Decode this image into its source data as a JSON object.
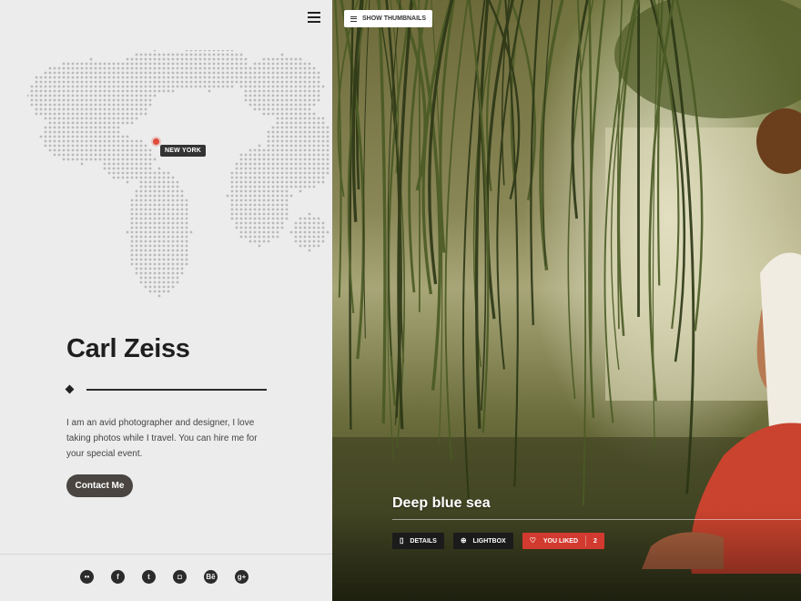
{
  "profile": {
    "name": "Carl Zeiss",
    "bio": "I am an avid photographer and designer, I love taking photos while I travel. You can hire me for your special event.",
    "contact_label": "Contact Me",
    "location_label": "NEW YORK"
  },
  "social": [
    {
      "icon": "flickr-icon",
      "glyph": "••"
    },
    {
      "icon": "facebook-icon",
      "glyph": "f"
    },
    {
      "icon": "twitter-icon",
      "glyph": "t"
    },
    {
      "icon": "instagram-icon",
      "glyph": "◘"
    },
    {
      "icon": "behance-icon",
      "glyph": "Bē"
    },
    {
      "icon": "googleplus-icon",
      "glyph": "g+"
    }
  ],
  "gallery": {
    "show_thumbnails_label": "SHOW THUMBNAILS",
    "photo_title": "Deep blue sea",
    "details_label": "DETAILS",
    "lightbox_label": "LIGHTBOX",
    "liked_label": "YOU LIKED",
    "like_count": "2"
  },
  "colors": {
    "accent": "#d23a2f",
    "pin": "#e04a3a",
    "button": "#4a4540"
  }
}
